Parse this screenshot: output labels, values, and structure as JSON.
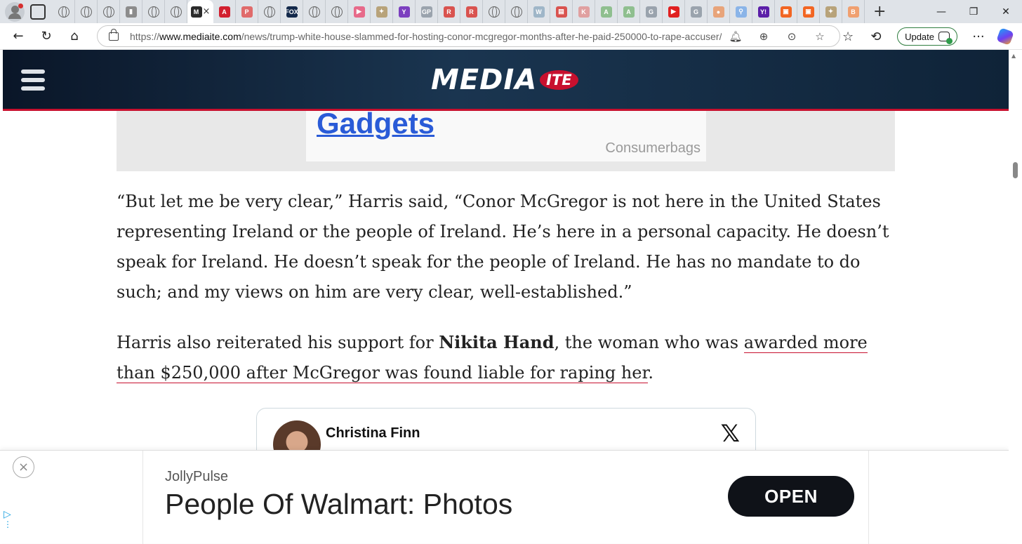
{
  "browser": {
    "tab_close_glyph": "×",
    "new_tab_glyph": "+",
    "window_controls": {
      "minimize": "—",
      "restore": "❐",
      "close": "✕"
    },
    "url": {
      "scheme": "https://",
      "host": "www.mediaite.com",
      "path": "/news/trump-white-house-slammed-for-hosting-conor-mcgregor-months-after-he-paid-250000-to-rape-accuser/"
    },
    "update_button_label": "Update",
    "more_glyph": "···",
    "tab_favicons": [
      {
        "icon": "globe-icon"
      },
      {
        "icon": "globe-icon"
      },
      {
        "icon": "globe-icon"
      },
      {
        "icon": "generic-favicon",
        "letter": "▮",
        "color": "#8c8c8c"
      },
      {
        "icon": "globe-icon"
      },
      {
        "icon": "globe-icon"
      },
      {
        "icon": "active-tab",
        "letter": "M",
        "color": "#2b2b2b"
      },
      {
        "icon": "generic-favicon",
        "letter": "A",
        "color": "#d21f2f"
      },
      {
        "icon": "generic-favicon",
        "letter": "P",
        "color": "#e06b6b"
      },
      {
        "icon": "globe-icon"
      },
      {
        "icon": "generic-favicon",
        "letter": "FOX",
        "color": "#13294b"
      },
      {
        "icon": "globe-icon"
      },
      {
        "icon": "globe-icon"
      },
      {
        "icon": "generic-favicon",
        "letter": "▶",
        "color": "#e76a8a"
      },
      {
        "icon": "generic-favicon",
        "letter": "✦",
        "color": "#b8a37a"
      },
      {
        "icon": "generic-favicon",
        "letter": "Y",
        "color": "#7b3fbf"
      },
      {
        "icon": "generic-favicon",
        "letter": "GP",
        "color": "#9aa3ad"
      },
      {
        "icon": "generic-favicon",
        "letter": "R",
        "color": "#d9534f"
      },
      {
        "icon": "generic-favicon",
        "letter": "R",
        "color": "#d9534f"
      },
      {
        "icon": "globe-icon"
      },
      {
        "icon": "globe-icon"
      },
      {
        "icon": "generic-favicon",
        "letter": "W",
        "color": "#9fb6c8"
      },
      {
        "icon": "generic-favicon",
        "letter": "▤",
        "color": "#d9534f"
      },
      {
        "icon": "generic-favicon",
        "letter": "K",
        "color": "#e0a0a0"
      },
      {
        "icon": "generic-favicon",
        "letter": "A",
        "color": "#8fbf8f"
      },
      {
        "icon": "generic-favicon",
        "letter": "A",
        "color": "#8fbf8f"
      },
      {
        "icon": "generic-favicon",
        "letter": "G",
        "color": "#9aa3ad"
      },
      {
        "icon": "generic-favicon",
        "letter": "▶",
        "color": "#e02020"
      },
      {
        "icon": "generic-favicon",
        "letter": "G",
        "color": "#9aa3ad"
      },
      {
        "icon": "generic-favicon",
        "letter": "●",
        "color": "#e8a47a"
      },
      {
        "icon": "generic-favicon",
        "letter": "⚲",
        "color": "#8ab4e8"
      },
      {
        "icon": "generic-favicon",
        "letter": "Y!",
        "color": "#5b1fa8"
      },
      {
        "icon": "generic-favicon",
        "letter": "▣",
        "color": "#f26522"
      },
      {
        "icon": "generic-favicon",
        "letter": "▣",
        "color": "#f26522"
      },
      {
        "icon": "generic-favicon",
        "letter": "✦",
        "color": "#b8a37a"
      },
      {
        "icon": "generic-favicon",
        "letter": "B",
        "color": "#f0a070"
      }
    ]
  },
  "site": {
    "logo_main": "MEDIA",
    "logo_badge": "ITE",
    "brand_color": "#c8102e"
  },
  "top_ad": {
    "headline": "Gadgets",
    "sponsor": "Consumerbags"
  },
  "article": {
    "paragraph1": "“But let me be very clear,” Harris said, “Conor McGregor is not here in the United States representing Ireland or the people of Ireland. He’s here in a personal capacity. He doesn’t speak for Ireland. He doesn’t speak for the people of Ireland. He has no mandate to do such; and my views on him are very clear, well-established.”",
    "p2_before": "Harris also reiterated his support for ",
    "p2_bold": "Nikita Hand",
    "p2_middle": ", the woman who was ",
    "p2_link": "awarded more than $250,000 after McGregor was found liable for raping her",
    "p2_end": "."
  },
  "tweet": {
    "author": "Christina Finn",
    "platform_logo": "𝕏"
  },
  "bottom_ad": {
    "close_glyph": "×",
    "brand": "JollyPulse",
    "headline": "People Of Walmart: Photos",
    "cta": "OPEN"
  }
}
